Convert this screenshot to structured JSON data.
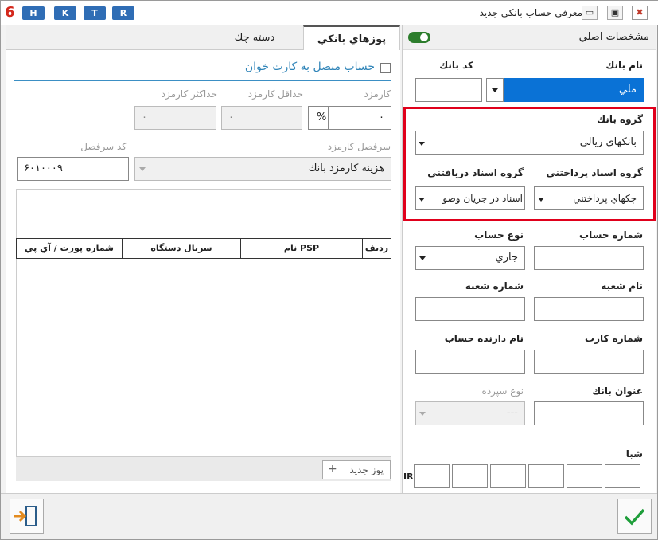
{
  "window": {
    "title": "معرفي حساب بانكي جديد"
  },
  "toolbar": {
    "logo": "6",
    "buttons": [
      "H",
      "K",
      "T",
      "R"
    ]
  },
  "right_panel": {
    "header": "مشخصات اصلي",
    "bank_name_label": "نام بانك",
    "bank_name_value": "ملي",
    "bank_code_label": "كد بانك",
    "bank_code_value": "",
    "bank_group_label": "گروه بانك",
    "bank_group_value": "بانكهاي ريالي",
    "payment_docs_label": "گروه اسناد پرداختني",
    "payment_docs_value": "چكهاي پرداختني",
    "receive_docs_label": "گروه اسناد دريافتني",
    "receive_docs_value": "اسناد در جريان وصو",
    "account_number_label": "شماره حساب",
    "account_type_label": "نوع حساب",
    "account_type_value": "جاري",
    "branch_name_label": "نام شعبه",
    "branch_number_label": "شماره شعبه",
    "card_number_label": "شماره كارت",
    "holder_name_label": "نام دارنده حساب",
    "bank_title_label": "عنوان بانك",
    "deposit_type_label": "نوع سپرده",
    "deposit_type_value": "---",
    "sheba_label": "شبا",
    "sheba_prefix": "IR"
  },
  "left_panel": {
    "tabs": [
      "پوزهاي بانكي",
      "دسته چك"
    ],
    "card_reader_checkbox": "حساب متصل به كارت خوان",
    "fee_label": "كارمزد",
    "fee_value": "۰",
    "fee_unit": "%",
    "min_fee_label": "حداقل كارمزد",
    "min_fee_value": "۰",
    "max_fee_label": "حداكثر كارمزد",
    "max_fee_value": "۰",
    "fee_ledger_label": "سرفصل كارمزد",
    "fee_ledger_value": "هزينه كارمزد بانك",
    "ledger_code_label": "كد سرفصل",
    "ledger_code_value": "۶۰۱۰۰۰۹",
    "grid_columns": [
      "رديف",
      "نام PSP",
      "سريال دستگاه",
      "شماره پورت / آي پي"
    ],
    "new_pos_button": "پوز جديد"
  },
  "colors": {
    "accent": "#0a72d6",
    "highlight_border": "#e0001b",
    "confirm": "#1e9e3a",
    "exit": "#e38b1f"
  }
}
